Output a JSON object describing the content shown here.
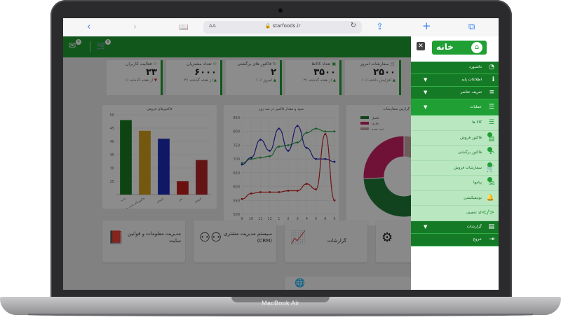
{
  "device": {
    "label": "MacBook Air"
  },
  "browser": {
    "aa_label": "AA",
    "url": "starfoods.ir"
  },
  "header": {
    "mail_badge": "+",
    "cart_badge": "+"
  },
  "stats": [
    {
      "title": "سفارشات امروز",
      "value": "۲۵۰۰",
      "foot": "۱۰٪ افزایش داشته",
      "trend": "up"
    },
    {
      "title": "تعداد کالاها",
      "value": "۳۵۰۰",
      "foot": "۳٪ از هفته گذشته",
      "trend": "up"
    },
    {
      "title": "فاکتور های برگشتی",
      "value": "۲",
      "foot": "۱۰٪ امروز",
      "trend": "up"
    },
    {
      "title": "تعداد مشتریان",
      "value": "۶۰۰۰",
      "foot": "۳٪ از هفته گذشته",
      "trend": "up"
    },
    {
      "title": "فعالیت کاربران",
      "value": "۳۳",
      "foot": "۱٪ از هفته گذشته",
      "trend": "down"
    }
  ],
  "colors": {
    "accent": "#1f9f34",
    "accent_light": "#b9e7c0",
    "overlay": "rgba(0,0,0,0.45)"
  },
  "chart_data": [
    {
      "type": "bar",
      "title": "فاکتورهای فروش",
      "categories": [
        "جدید",
        "فاکتورهای شده مشتری",
        "فروش",
        "پس",
        "فروش"
      ],
      "values": [
        48,
        44,
        41,
        25,
        33
      ],
      "colors": [
        "#1a7a22",
        "#d6a01e",
        "#1e2ab8",
        "#c31d1d",
        "#b3262b"
      ],
      "ylim": [
        20,
        50
      ],
      "yticks": [
        25,
        30,
        35,
        40,
        45,
        50
      ]
    },
    {
      "type": "line",
      "title": "سود و مقدار فاکتور در سه روز",
      "x": [
        "9",
        "10",
        "11",
        "12",
        "1",
        "2",
        "3",
        "4",
        "5",
        "6",
        "5"
      ],
      "ylim": [
        500,
        850
      ],
      "yticks": [
        500,
        550,
        600,
        650,
        700,
        750,
        800,
        850
      ],
      "series": [
        {
          "color": "#2aa44a",
          "values": [
            685,
            700,
            705,
            710,
            745,
            750,
            760,
            795,
            810,
            800,
            800
          ]
        },
        {
          "color": "#2b2bb8",
          "values": [
            680,
            705,
            770,
            730,
            810,
            730,
            820,
            740,
            700,
            700,
            690
          ]
        },
        {
          "color": "#cc2222",
          "values": [
            555,
            575,
            580,
            580,
            580,
            585,
            585,
            610,
            590,
            790,
            550
          ]
        }
      ]
    },
    {
      "type": "pie",
      "title": "گزارش سفارشات",
      "legend": [
        "تکمیل",
        "جاری",
        "ثبت شده"
      ],
      "values": [
        14,
        18,
        12,
        30,
        26
      ],
      "colors": [
        "#c8a8a8",
        "#2a7f8a",
        "#1e4e8a",
        "#1f7a3a",
        "#cc2266"
      ]
    }
  ],
  "tiles": [
    {
      "label": "مدیریت معلومات و قوانین سایت"
    },
    {
      "label": "سیستم مدیریت مشتری (CRM)"
    },
    {
      "label": "گزارشات"
    }
  ],
  "drawer": {
    "home_title": "خانه",
    "items": [
      {
        "label": "داشبورد",
        "type": "main"
      },
      {
        "label": "اطلاعات پایه",
        "type": "main",
        "caret": true
      },
      {
        "label": "تعریف عناصر",
        "type": "main",
        "caret": true
      },
      {
        "label": "عملیات",
        "type": "main",
        "caret": true,
        "active": true
      },
      {
        "label": "کالا ها",
        "type": "sub"
      },
      {
        "label": "فاکتور فروش",
        "type": "sub",
        "dot": true
      },
      {
        "label": "فاکتور برگشتی",
        "type": "sub",
        "dot": true
      },
      {
        "label": "سفارشات فروش",
        "type": "sub",
        "dot": true
      },
      {
        "label": "پیامها",
        "type": "sub",
        "dot": true
      },
      {
        "label": "نوتیفیکیشن",
        "type": "sub"
      },
      {
        "label": "کد تخفیف",
        "type": "sub"
      },
      {
        "label": "گزارشات",
        "type": "main",
        "caret": true
      },
      {
        "label": "خروج",
        "type": "main"
      }
    ]
  }
}
